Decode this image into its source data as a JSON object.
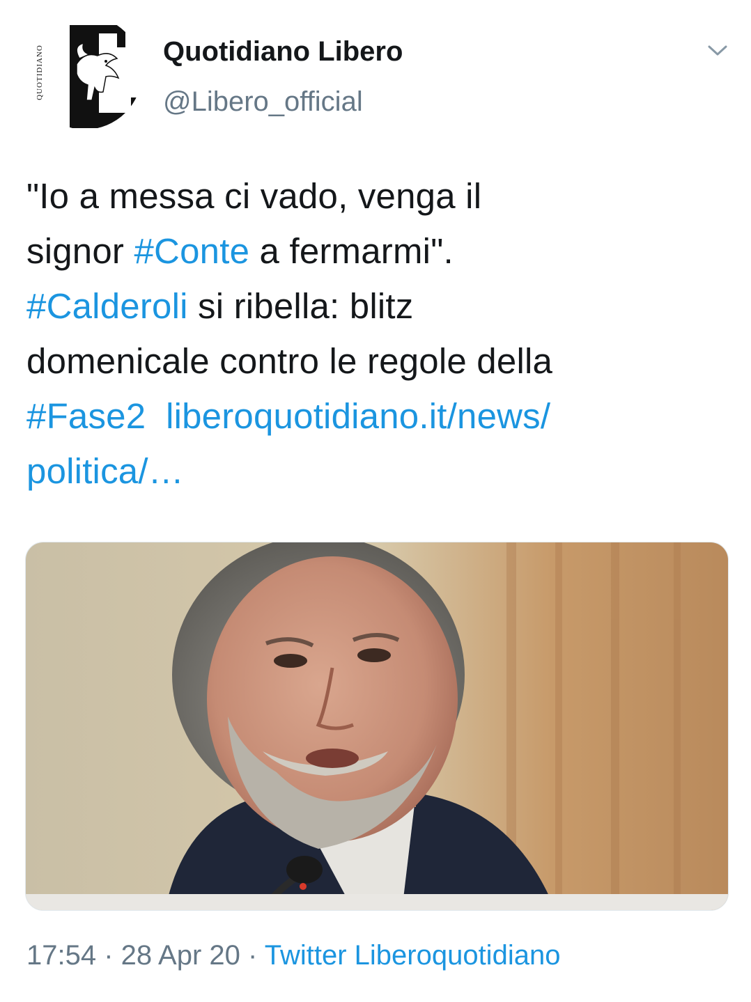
{
  "author": {
    "display_name": "Quotidiano Libero",
    "handle": "@Libero_official",
    "avatar_text": "QUOTIDIANO"
  },
  "tweet": {
    "line1": "\"Io a messa ci vado, venga il",
    "line2_pre": "signor ",
    "line2_tag": "#Conte",
    "line2_post": " a fermarmi\".",
    "line3_tag": "#Calderoli",
    "line3_post": " si ribella: blitz",
    "line4": "domenicale contro le regole della",
    "line5_tag": "#Fase2",
    "line5_link": "liberoquotidiano.it/news/",
    "line6_link": "politica/…"
  },
  "meta": {
    "time": "17:54",
    "separator": " · ",
    "date": "28 Apr 20",
    "source": "Twitter Liberoquotidiano"
  },
  "colors": {
    "link": "#1b95e0",
    "text": "#14171a",
    "secondary": "#657786"
  },
  "icons": {
    "more": "chevron-down-icon"
  }
}
